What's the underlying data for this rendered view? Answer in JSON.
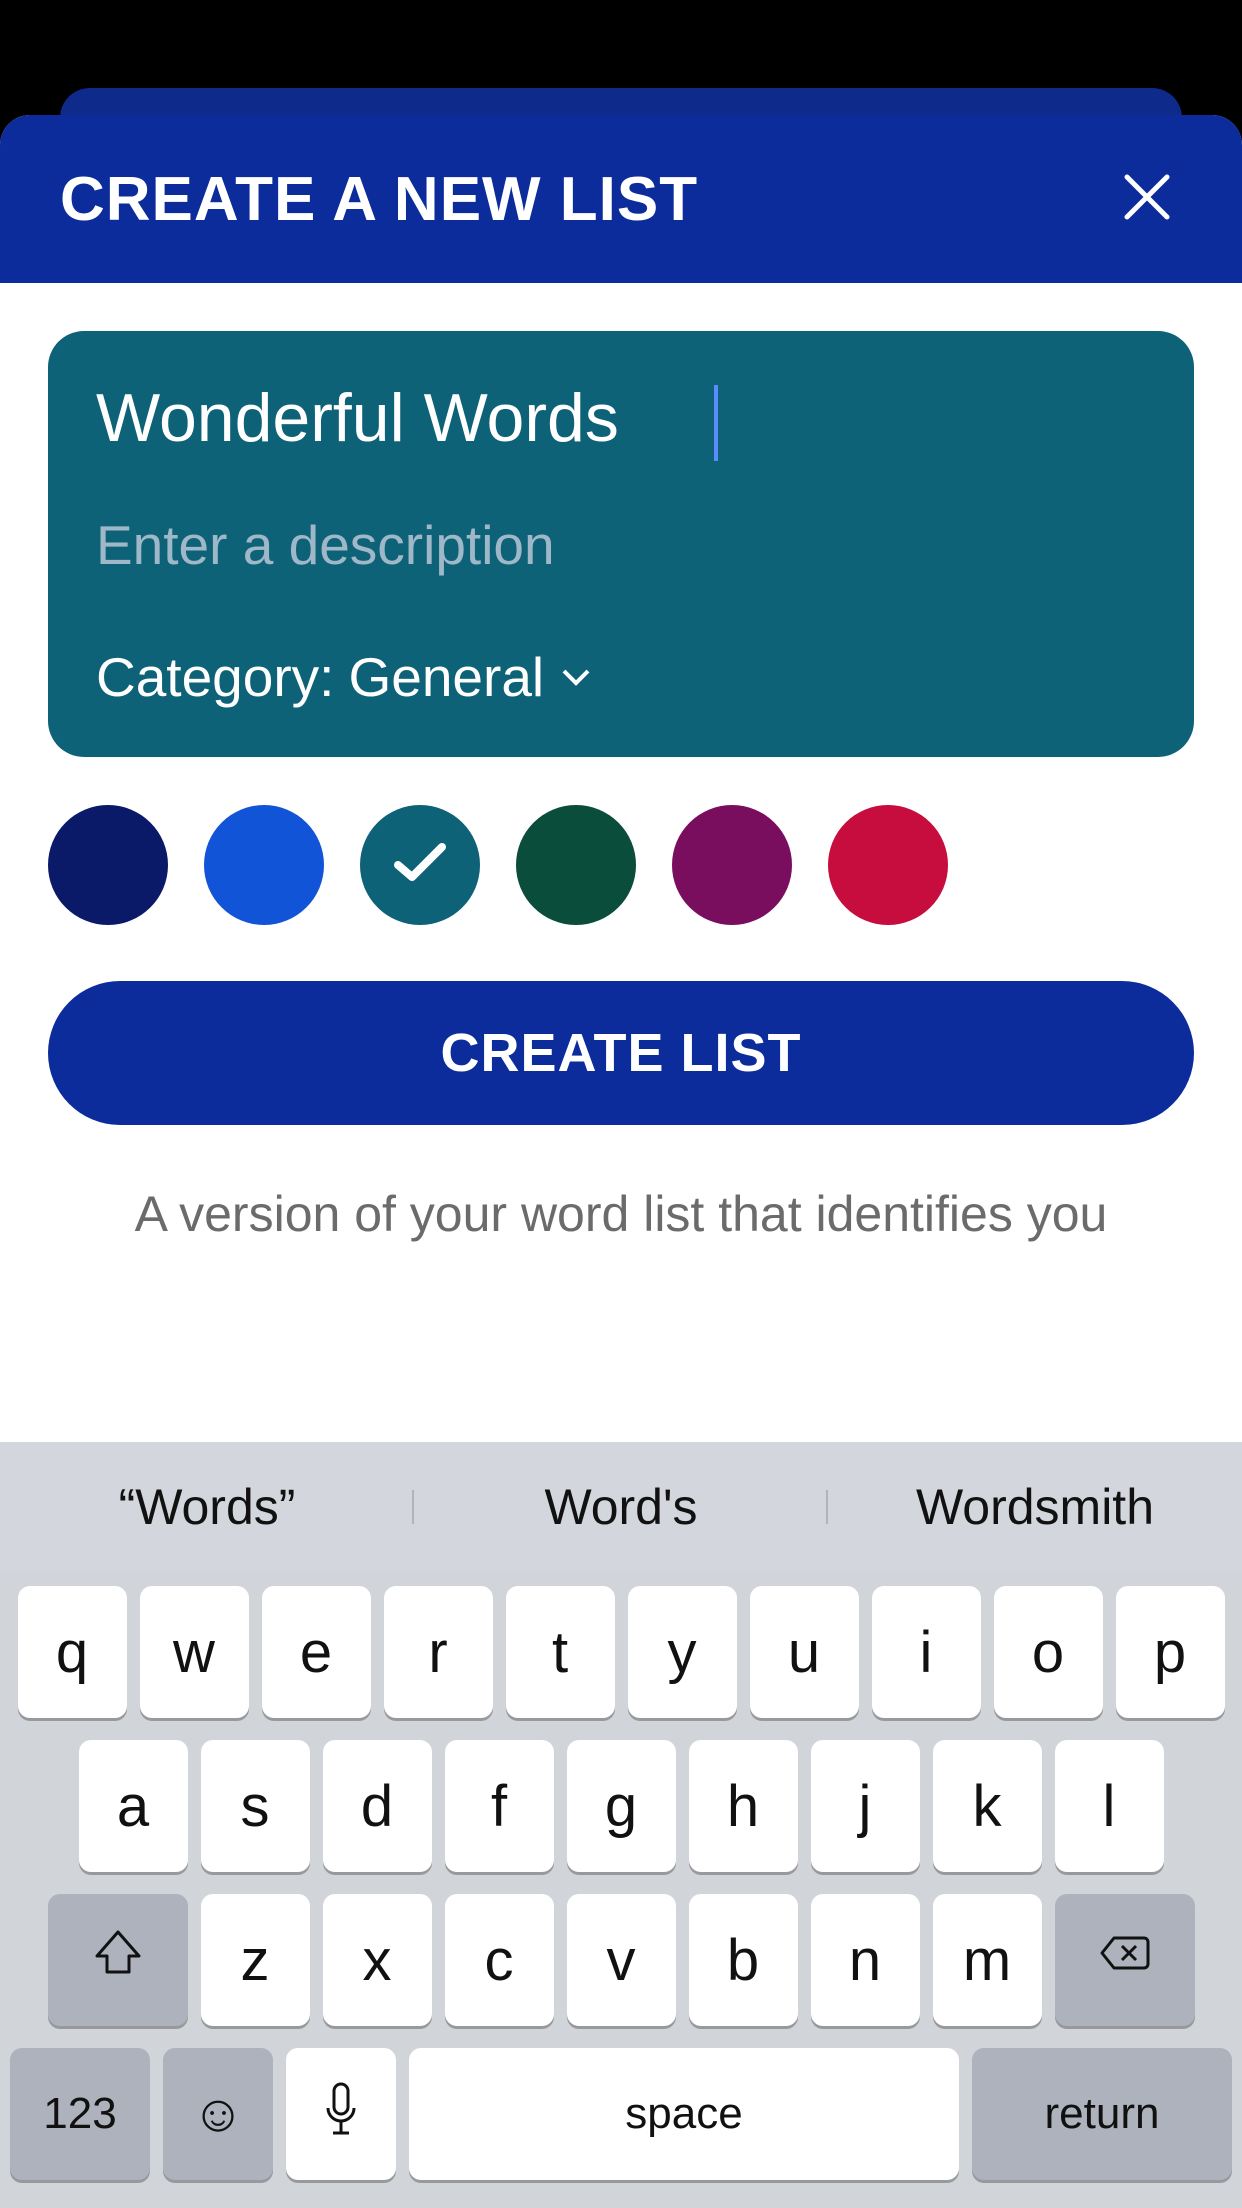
{
  "header": {
    "title": "CREATE A NEW LIST"
  },
  "form": {
    "title_value": "Wonderful Words",
    "description_placeholder": "Enter a description",
    "category_label": "Category:",
    "category_value": "General"
  },
  "colors": [
    {
      "hex": "#0a1a68",
      "selected": false
    },
    {
      "hex": "#1254d8",
      "selected": false
    },
    {
      "hex": "#0e6278",
      "selected": true
    },
    {
      "hex": "#0a4d3a",
      "selected": false
    },
    {
      "hex": "#7a0e5e",
      "selected": false
    },
    {
      "hex": "#c60d3e",
      "selected": false
    }
  ],
  "create_button": "CREATE LIST",
  "info_text": "A version of your word list that identifies you",
  "keyboard": {
    "suggestions": [
      "“Words”",
      "Word's",
      "Wordsmith"
    ],
    "row1": [
      "q",
      "w",
      "e",
      "r",
      "t",
      "y",
      "u",
      "i",
      "o",
      "p"
    ],
    "row2": [
      "a",
      "s",
      "d",
      "f",
      "g",
      "h",
      "j",
      "k",
      "l"
    ],
    "row3": [
      "z",
      "x",
      "c",
      "v",
      "b",
      "n",
      "m"
    ],
    "key_123": "123",
    "key_space": "space",
    "key_return": "return"
  }
}
